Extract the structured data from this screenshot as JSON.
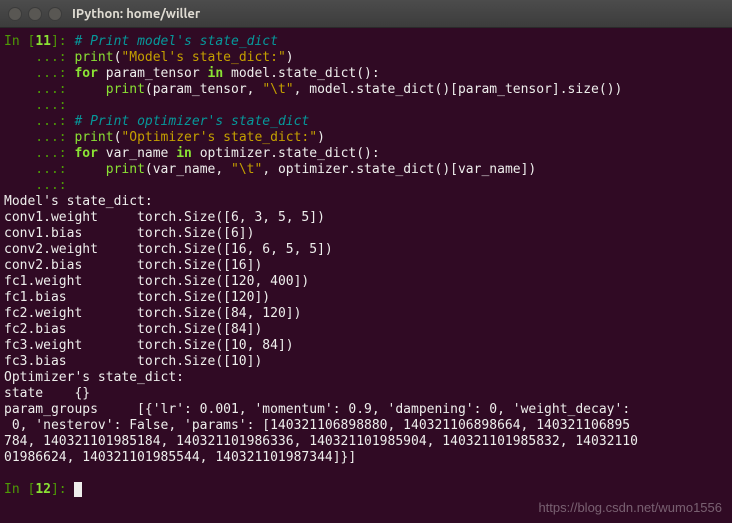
{
  "window": {
    "title": "IPython: home/willer"
  },
  "prompt": {
    "in11_open": "In [",
    "in11_num": "11",
    "in11_close": "]: ",
    "cont": "    ...: ",
    "in12_open": "In [",
    "in12_num": "12",
    "in12_close": "]: "
  },
  "code": {
    "c1": "# Print model's state_dict",
    "p1a": "print",
    "p1b": "(",
    "p1c": "\"Model's state_dict:\"",
    "p1d": ")",
    "for1a": "for",
    "for1b": " param_tensor ",
    "for1c": "in",
    "for1d": " model.state_dict():",
    "p2a": "    print",
    "p2b": "(param_tensor, ",
    "p2c": "\"\\t\"",
    "p2d": ", model.state_dict()[param_tensor].size())",
    "blank": "",
    "c2": "# Print optimizer's state_dict",
    "p3a": "print",
    "p3b": "(",
    "p3c": "\"Optimizer's state_dict:\"",
    "p3d": ")",
    "for2a": "for",
    "for2b": " var_name ",
    "for2c": "in",
    "for2d": " optimizer.state_dict():",
    "p4a": "    print",
    "p4b": "(var_name, ",
    "p4c": "\"\\t\"",
    "p4d": ", optimizer.state_dict()[var_name])"
  },
  "output": {
    "l1": "Model's state_dict:",
    "l2": "conv1.weight \t torch.Size([6, 3, 5, 5])",
    "l3": "conv1.bias \t torch.Size([6])",
    "l4": "conv2.weight \t torch.Size([16, 6, 5, 5])",
    "l5": "conv2.bias \t torch.Size([16])",
    "l6": "fc1.weight \t torch.Size([120, 400])",
    "l7": "fc1.bias \t torch.Size([120])",
    "l8": "fc2.weight \t torch.Size([84, 120])",
    "l9": "fc2.bias \t torch.Size([84])",
    "l10": "fc3.weight \t torch.Size([10, 84])",
    "l11": "fc3.bias \t torch.Size([10])",
    "l12": "Optimizer's state_dict:",
    "l13": "state \t {}",
    "l14": "param_groups \t [{'lr': 0.001, 'momentum': 0.9, 'dampening': 0, 'weight_decay':",
    "l15": " 0, 'nesterov': False, 'params': [140321106898880, 140321106898664, 140321106895",
    "l16": "784, 140321101985184, 140321101986336, 140321101985904, 140321101985832, 14032110",
    "l17": "01986624, 140321101985544, 140321101987344]}]"
  },
  "watermark": "https://blog.csdn.net/wumo1556"
}
